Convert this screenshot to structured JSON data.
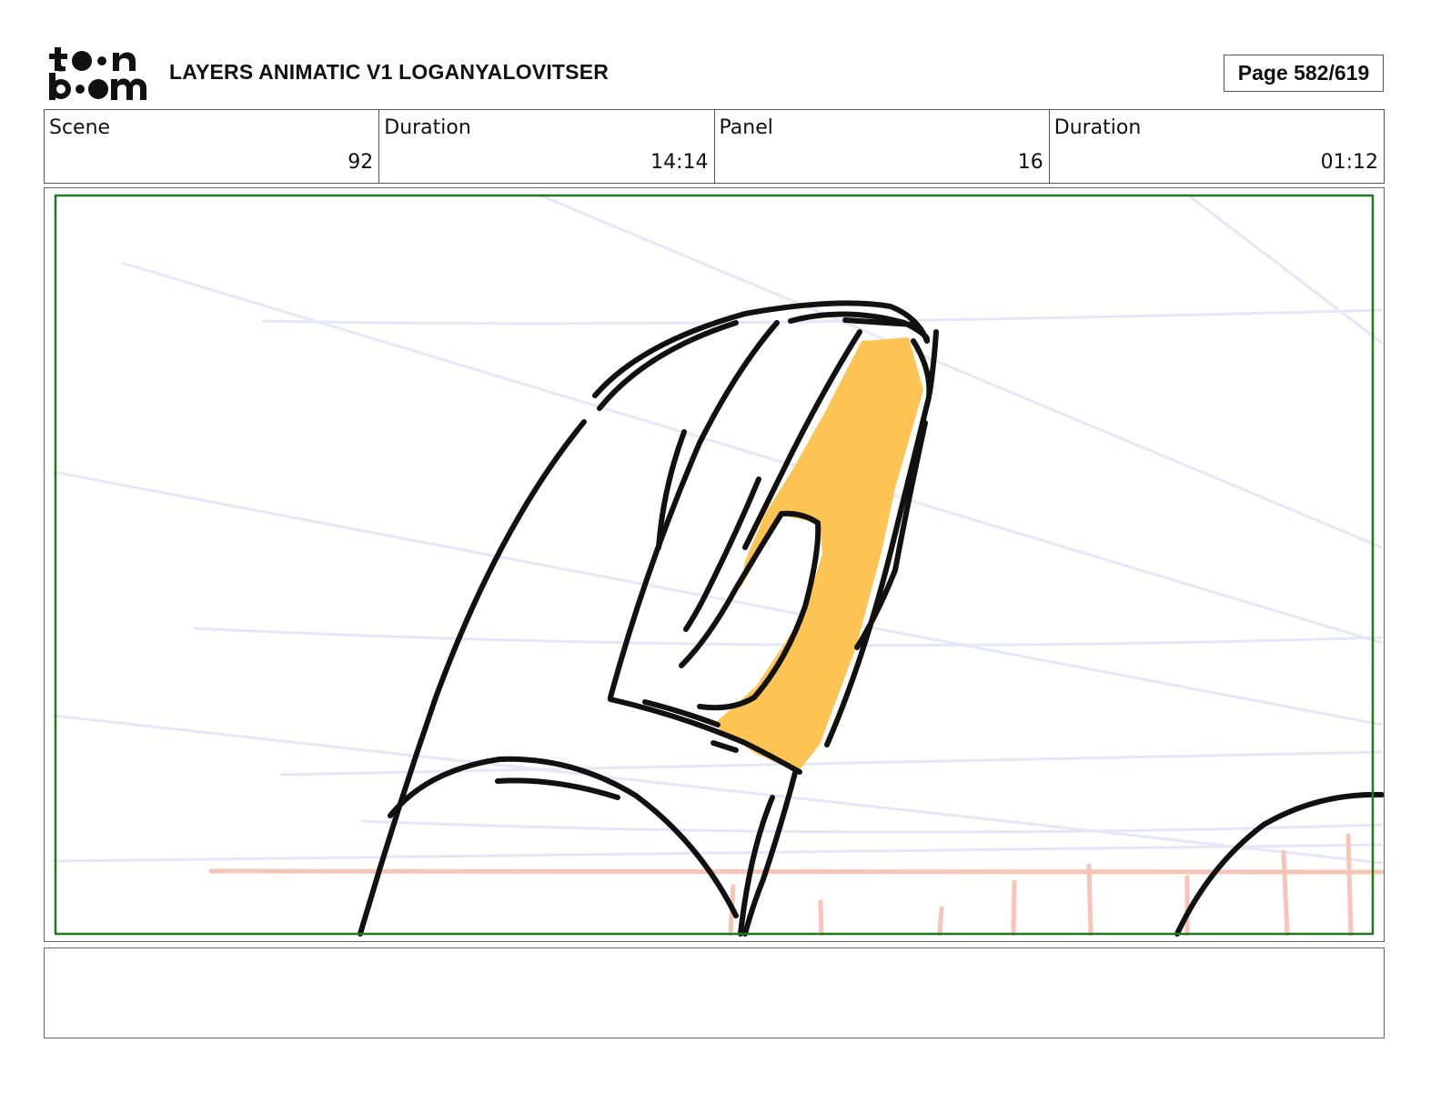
{
  "header": {
    "brand": "toon boom",
    "title": "LAYERS ANIMATIC V1 LOGANYALOVITSER",
    "page": "Page 582/619"
  },
  "info": {
    "scene_label": "Scene",
    "scene_value": "92",
    "scene_duration_label": "Duration",
    "scene_duration_value": "14:14",
    "panel_label": "Panel",
    "panel_value": "16",
    "panel_duration_label": "Duration",
    "panel_duration_value": "01:12"
  },
  "panel": {
    "safe_frame_color": "#1f7a1f",
    "fill_color": "#fdc453",
    "guide_line_color": "#e4e4fb",
    "horizon_color": "#f8c4b8"
  },
  "notes": {
    "text": ""
  }
}
